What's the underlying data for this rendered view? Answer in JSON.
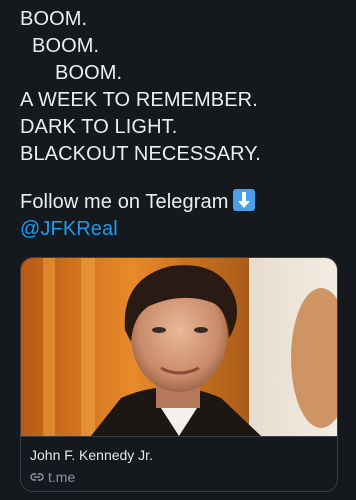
{
  "tweet": {
    "lines": [
      "BOOM.",
      "BOOM.",
      "BOOM.",
      "A WEEK TO REMEMBER.",
      "DARK TO LIGHT.",
      "BLACKOUT NECESSARY."
    ],
    "follow_text": "Follow me on Telegram",
    "follow_icon": "down-arrow-emoji-icon",
    "mention": "@JFKReal"
  },
  "card": {
    "image_icon": "portrait-photo",
    "title": "John F. Kennedy Jr.",
    "domain": "t.me",
    "domain_icon": "link-icon"
  },
  "colors": {
    "background": "#15181c",
    "text": "#eceef0",
    "link": "#1d9bf0",
    "muted": "#8b98a5",
    "border": "#3a3f45"
  }
}
